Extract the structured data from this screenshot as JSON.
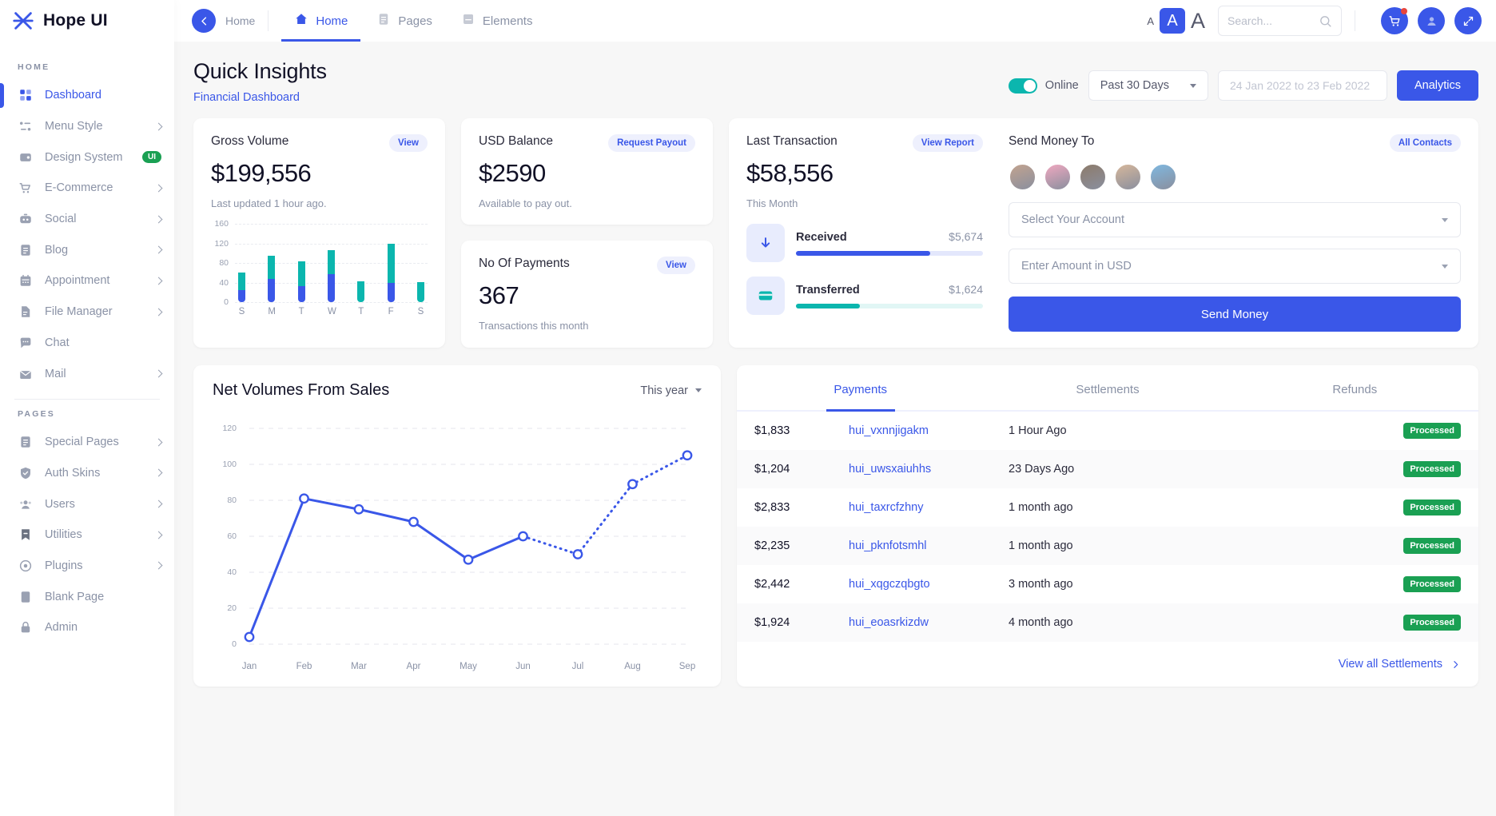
{
  "brand": {
    "name": "Hope UI",
    "logo_icon": "hope-ui-logo-icon"
  },
  "topbar": {
    "back_icon": "arrow-left-icon",
    "breadcrumb": "Home",
    "tabs": [
      {
        "label": "Home",
        "icon": "home-icon",
        "active": true
      },
      {
        "label": "Pages",
        "icon": "pages-icon",
        "active": false
      },
      {
        "label": "Elements",
        "icon": "elements-icon",
        "active": false
      }
    ],
    "font_sizes": [
      "A",
      "A",
      "A"
    ],
    "font_size_selected_index": 1,
    "search": {
      "placeholder": "Search...",
      "value": "",
      "icon": "search-icon"
    },
    "actions": [
      {
        "name": "cart-icon",
        "has_badge": true
      },
      {
        "name": "user-icon",
        "has_badge": false
      },
      {
        "name": "fullscreen-icon",
        "has_badge": false
      }
    ]
  },
  "sidebar": {
    "sections": [
      {
        "caption": "HOME",
        "items": [
          {
            "label": "Dashboard",
            "icon": "grid-icon",
            "active": true,
            "chevron": false,
            "badge": ""
          },
          {
            "label": "Menu Style",
            "icon": "list-icon",
            "active": false,
            "chevron": true,
            "badge": ""
          },
          {
            "label": "Design System",
            "icon": "wallet-icon",
            "active": false,
            "chevron": false,
            "badge": "UI"
          },
          {
            "label": "E-Commerce",
            "icon": "cart-icon",
            "active": false,
            "chevron": true,
            "badge": ""
          },
          {
            "label": "Social",
            "icon": "camera-icon",
            "active": false,
            "chevron": true,
            "badge": ""
          },
          {
            "label": "Blog",
            "icon": "document-icon",
            "active": false,
            "chevron": true,
            "badge": ""
          },
          {
            "label": "Appointment",
            "icon": "calendar-icon",
            "active": false,
            "chevron": true,
            "badge": ""
          },
          {
            "label": "File Manager",
            "icon": "file-icon",
            "active": false,
            "chevron": true,
            "badge": ""
          },
          {
            "label": "Chat",
            "icon": "chat-icon",
            "active": false,
            "chevron": false,
            "badge": ""
          },
          {
            "label": "Mail",
            "icon": "mail-icon",
            "active": false,
            "chevron": true,
            "badge": ""
          }
        ]
      },
      {
        "caption": "PAGES",
        "items": [
          {
            "label": "Special Pages",
            "icon": "document-icon",
            "active": false,
            "chevron": true,
            "badge": ""
          },
          {
            "label": "Auth Skins",
            "icon": "shield-icon",
            "active": false,
            "chevron": true,
            "badge": ""
          },
          {
            "label": "Users",
            "icon": "users-icon",
            "active": false,
            "chevron": true,
            "badge": ""
          },
          {
            "label": "Utilities",
            "icon": "bookmark-icon",
            "active": false,
            "chevron": true,
            "badge": ""
          },
          {
            "label": "Plugins",
            "icon": "plugin-icon",
            "active": false,
            "chevron": true,
            "badge": ""
          },
          {
            "label": "Blank Page",
            "icon": "blank-icon",
            "active": false,
            "chevron": false,
            "badge": ""
          },
          {
            "label": "Admin",
            "icon": "lock-icon",
            "active": false,
            "chevron": false,
            "badge": ""
          }
        ]
      }
    ]
  },
  "page": {
    "title": "Quick Insights",
    "subtitle": "Financial Dashboard",
    "online_label": "Online",
    "online_on": true,
    "range_label": "Past 30 Days",
    "date_placeholder": "24 Jan 2022 to 23 Feb 2022",
    "analytics_label": "Analytics"
  },
  "gross_volume": {
    "title": "Gross Volume",
    "action": "View",
    "amount": "$199,556",
    "note": "Last updated 1 hour ago."
  },
  "usd_balance": {
    "title": "USD Balance",
    "action": "Request Payout",
    "amount": "$2590",
    "note": "Available to pay out."
  },
  "payments": {
    "title": "No Of Payments",
    "action": "View",
    "amount": "367",
    "note": "Transactions this month"
  },
  "last_transaction": {
    "title": "Last Transaction",
    "action": "View Report",
    "amount": "$58,556",
    "note": "This Month",
    "stats": [
      {
        "name": "Received",
        "value": "$5,674",
        "icon": "arrow-down-icon",
        "percent": 72,
        "color": "#3a57e8",
        "track": "#e3e7fc",
        "bg": "#e8ecfd"
      },
      {
        "name": "Transferred",
        "value": "$1,624",
        "icon": "card-icon",
        "percent": 34,
        "color": "#0bb6ae",
        "track": "#e1f6f5",
        "bg": "#e8ecfd"
      }
    ]
  },
  "send_money": {
    "title": "Send Money To",
    "action": "All Contacts",
    "avatars": [
      "#c2a38f",
      "#f0a8c0",
      "#8d7b6b",
      "#d6b79b",
      "#7fb8e0"
    ],
    "account_placeholder": "Select Your Account",
    "amount_placeholder": "Enter Amount in USD",
    "send_label": "Send Money"
  },
  "transactions": {
    "tabs": [
      {
        "label": "Payments",
        "active": true
      },
      {
        "label": "Settlements",
        "active": false
      },
      {
        "label": "Refunds",
        "active": false
      }
    ],
    "rows": [
      {
        "amount": "$1,833",
        "id": "hui_vxnnjigakm",
        "when": "1 Hour Ago",
        "status": "Processed"
      },
      {
        "amount": "$1,204",
        "id": "hui_uwsxaiuhhs",
        "when": "23 Days Ago",
        "status": "Processed"
      },
      {
        "amount": "$2,833",
        "id": "hui_taxrcfzhny",
        "when": "1 month ago",
        "status": "Processed"
      },
      {
        "amount": "$2,235",
        "id": "hui_pknfotsmhl",
        "when": "1 month ago",
        "status": "Processed"
      },
      {
        "amount": "$2,442",
        "id": "hui_xqgczqbgto",
        "when": "3 month ago",
        "status": "Processed"
      },
      {
        "amount": "$1,924",
        "id": "hui_eoasrkizdw",
        "when": "4 month ago",
        "status": "Processed"
      }
    ],
    "footer_label": "View all Settlements",
    "footer_icon": "chevron-right-icon"
  },
  "net_volumes": {
    "title": "Net Volumes From Sales",
    "range_label": "This year"
  },
  "chart_data": [
    {
      "type": "bar",
      "title": "Gross Volume",
      "categories": [
        "S",
        "M",
        "T",
        "W",
        "T",
        "F",
        "S"
      ],
      "series": [
        {
          "name": "Lower",
          "color": "#3a57e8",
          "values": [
            25,
            48,
            33,
            57,
            0,
            39,
            0
          ]
        },
        {
          "name": "Upper",
          "color": "#0bb6ae",
          "values": [
            36,
            47,
            50,
            49,
            42,
            80,
            41
          ]
        }
      ],
      "stacked": true,
      "ylim": [
        0,
        160
      ],
      "yticks": [
        0,
        40,
        80,
        120,
        160
      ],
      "grid": true,
      "xlabel": "",
      "ylabel": ""
    },
    {
      "type": "line",
      "title": "Net Volumes From Sales",
      "x": [
        "Jan",
        "Feb",
        "Mar",
        "Apr",
        "May",
        "Jun",
        "Jul",
        "Aug",
        "Sep"
      ],
      "values": [
        4,
        81,
        75,
        68,
        47,
        60,
        50,
        89,
        105
      ],
      "color": "#3a57e8",
      "dashed_from_index": 5,
      "ylim": [
        0,
        120
      ],
      "yticks": [
        0,
        20,
        40,
        60,
        80,
        100,
        120
      ],
      "grid": true,
      "xlabel": "",
      "ylabel": ""
    }
  ]
}
